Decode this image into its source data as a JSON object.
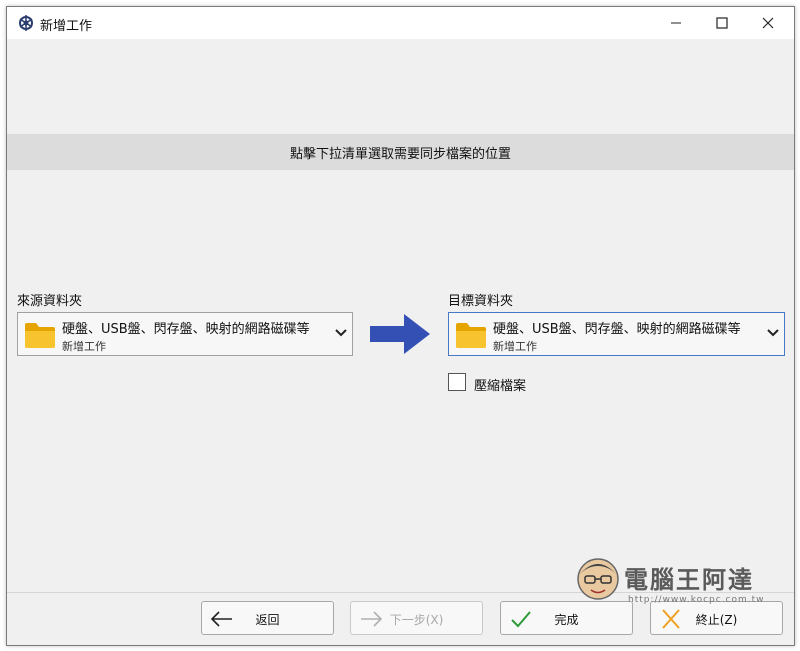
{
  "window": {
    "title": "新增工作",
    "controls": {
      "minimize": "—",
      "maximize": "☐",
      "close": "✕"
    }
  },
  "banner": {
    "text": "點擊下拉清單選取需要同步檔案的位置"
  },
  "source": {
    "label": "來源資料夾",
    "dropdown": {
      "line1": "硬盤、USB盤、閃存盤、映射的網路磁碟等",
      "line2": "新增工作",
      "icon": "folder-icon"
    }
  },
  "target": {
    "label": "目標資料夾",
    "dropdown": {
      "line1": "硬盤、USB盤、閃存盤、映射的網路磁碟等",
      "line2": "新增工作",
      "icon": "folder-icon"
    },
    "compress": {
      "label": "壓縮檔案",
      "checked": false
    }
  },
  "buttons": {
    "back": {
      "label": "返回",
      "icon": "arrow-left-icon",
      "enabled": true
    },
    "next": {
      "label": "下一步(X)",
      "icon": "arrow-right-icon",
      "enabled": false
    },
    "done": {
      "label": "完成",
      "icon": "check-icon",
      "enabled": true
    },
    "stop": {
      "label": "終止(Z)",
      "icon": "cross-icon",
      "enabled": true
    }
  },
  "watermark": {
    "title": "電腦王阿達",
    "url": "http://www.kocpc.com.tw"
  },
  "colors": {
    "arrow": "#3450b4",
    "folder": "#f5b700",
    "check": "#2e9a3a",
    "cross": "#f0a020",
    "focus_border": "#4a78c8"
  }
}
